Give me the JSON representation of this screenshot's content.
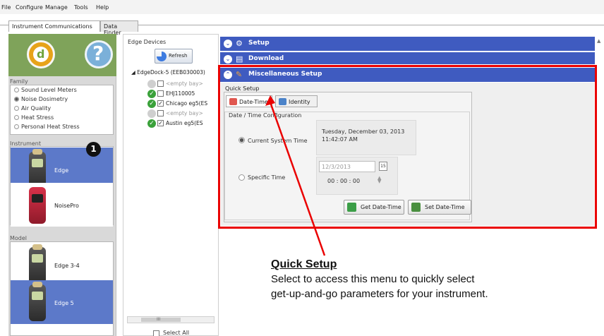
{
  "menu": [
    "File",
    "Configure",
    "Manage",
    "Tools",
    "Help"
  ],
  "tabs": [
    {
      "label": "Instrument Communications",
      "active": true
    },
    {
      "label": "Data Finder",
      "active": false
    }
  ],
  "left": {
    "family_label": "Family",
    "family_options": [
      {
        "label": "Sound Level Meters",
        "selected": false
      },
      {
        "label": "Noise Dosimetry",
        "selected": true
      },
      {
        "label": "Air Quality",
        "selected": false
      },
      {
        "label": "Heat Stress",
        "selected": false
      },
      {
        "label": "Personal Heat Stress",
        "selected": false
      }
    ],
    "instrument_label": "Instrument",
    "instruments": [
      {
        "label": "Edge",
        "selected": true
      },
      {
        "label": "NoisePro",
        "selected": false
      }
    ],
    "model_label": "Model",
    "models": [
      {
        "label": "Edge 3-4",
        "selected": false
      },
      {
        "label": "Edge 5",
        "selected": true
      }
    ],
    "callout": "1"
  },
  "devices": {
    "title": "Edge Devices",
    "refresh_label": "Refresh",
    "root": "EdgeDock-5 (EEB030003)",
    "items": [
      {
        "label": "<empty bay>",
        "status": "empty",
        "checked": false
      },
      {
        "label": "EHJ110005",
        "status": "ok",
        "checked": false
      },
      {
        "label": "Chicago eg5(ES",
        "status": "ok",
        "checked": true
      },
      {
        "label": "<empty bay>",
        "status": "empty",
        "checked": false
      },
      {
        "label": "Austin eg5(ES",
        "status": "ok",
        "checked": true
      }
    ],
    "scroll_marker": "III",
    "select_all_label": "Select All"
  },
  "sections": {
    "setup": "Setup",
    "download": "Download",
    "misc": "Miscellaneous Setup"
  },
  "quick_setup": {
    "label": "Quick Setup",
    "tab_date": "Date-Time",
    "tab_identity": "Identity",
    "group_label": "Date / Time Configuration",
    "current_label": "Current System Time",
    "current_date": "Tuesday, December 03, 2013",
    "current_time": "11:42:07 AM",
    "specific_label": "Specific Time",
    "date_value": "12/3/2013",
    "calendar_text": "15",
    "time_value": "00 : 00 : 00",
    "get_button": "Get Date-Time",
    "set_button": "Set Date-Time"
  },
  "annotation": {
    "title": "Quick Setup",
    "line1": "Select to access this menu to quickly select",
    "line2": "get-up-and-go parameters for your instrument."
  },
  "colors": {
    "accent_blue": "#3f5bc0",
    "selected_card": "#5c79c9",
    "highlight_red": "#ea0000",
    "status_green": "#3aa13a"
  }
}
